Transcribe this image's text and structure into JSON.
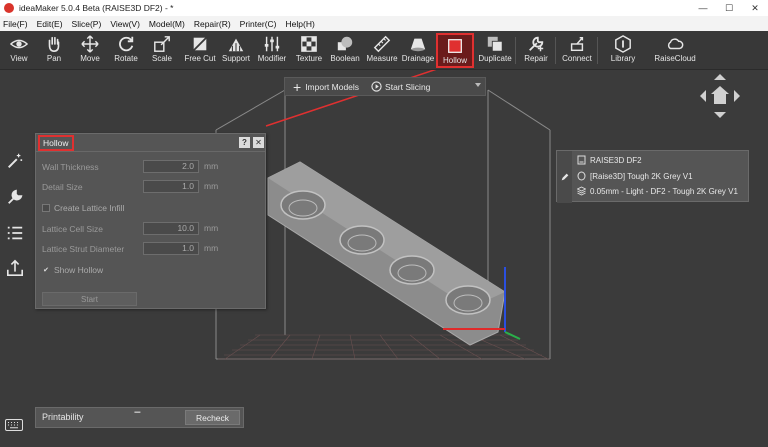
{
  "window": {
    "title": "ideaMaker 5.0.4 Beta (RAISE3D DF2) - *",
    "controls": [
      "—",
      "☐",
      "✕"
    ]
  },
  "menu": [
    "File(F)",
    "Edit(E)",
    "Slice(P)",
    "View(V)",
    "Model(M)",
    "Repair(R)",
    "Printer(C)",
    "Help(H)"
  ],
  "toolbar": {
    "items": [
      {
        "id": "view",
        "label": "View",
        "icon": "eye-icon"
      },
      {
        "id": "pan",
        "label": "Pan",
        "icon": "hand-icon"
      },
      {
        "id": "move",
        "label": "Move",
        "icon": "move-arrows-icon"
      },
      {
        "id": "rotate",
        "label": "Rotate",
        "icon": "rotate-icon"
      },
      {
        "id": "scale",
        "label": "Scale",
        "icon": "scale-icon"
      },
      {
        "id": "free-cut",
        "label": "Free Cut",
        "icon": "cut-icon"
      },
      {
        "id": "support",
        "label": "Support",
        "icon": "support-icon"
      },
      {
        "id": "modifier",
        "label": "Modifier",
        "icon": "sliders-icon"
      },
      {
        "id": "texture",
        "label": "Texture",
        "icon": "checker-icon"
      },
      {
        "id": "boolean",
        "label": "Boolean",
        "icon": "boolean-icon"
      },
      {
        "id": "measure",
        "label": "Measure",
        "icon": "ruler-icon"
      },
      {
        "id": "drainage",
        "label": "Drainage",
        "icon": "drainage-icon"
      },
      {
        "id": "hollow",
        "label": "Hollow",
        "icon": "hollow-cube-icon",
        "active": true
      },
      {
        "id": "duplicate",
        "label": "Duplicate",
        "icon": "duplicate-icon"
      },
      {
        "id": "repair",
        "label": "Repair",
        "icon": "wrench-icon"
      },
      {
        "id": "connect",
        "label": "Connect",
        "icon": "connect-icon"
      },
      {
        "id": "library",
        "label": "Library",
        "icon": "library-icon"
      },
      {
        "id": "raisecloud",
        "label": "RaiseCloud",
        "icon": "cloud-icon"
      }
    ]
  },
  "slicebar": {
    "import_label": "Import Models",
    "slice_label": "Start Slicing"
  },
  "hollow_panel": {
    "title": "Hollow",
    "help": "?",
    "close": "✕",
    "wall_thickness": {
      "label": "Wall Thickness",
      "value": "2.0",
      "unit": "mm"
    },
    "detail_size": {
      "label": "Detail Size",
      "value": "1.0",
      "unit": "mm"
    },
    "lattice_infill": {
      "label": "Create Lattice Infill",
      "checked": false
    },
    "lattice_cell": {
      "label": "Lattice Cell Size",
      "value": "10.0",
      "unit": "mm"
    },
    "lattice_strut": {
      "label": "Lattice Strut Diameter",
      "value": "1.0",
      "unit": "mm"
    },
    "show_hollow": {
      "label": "Show Hollow",
      "checked": true
    },
    "start_label": "Start"
  },
  "info_panel": {
    "printer": "RAISE3D DF2",
    "material": "[Raise3D] Tough 2K Grey V1",
    "profile": "0.05mm - Light - DF2 - Tough 2K Grey V1"
  },
  "printability": {
    "label": "Printability",
    "recheck_label": "Recheck"
  },
  "colors": {
    "accent_red": "#e03030",
    "bg": "#3b3b3b",
    "panel": "#555555",
    "axis_z": "#2a4fe0",
    "axis_x": "#e02a2a",
    "axis_y": "#2ab04a"
  }
}
